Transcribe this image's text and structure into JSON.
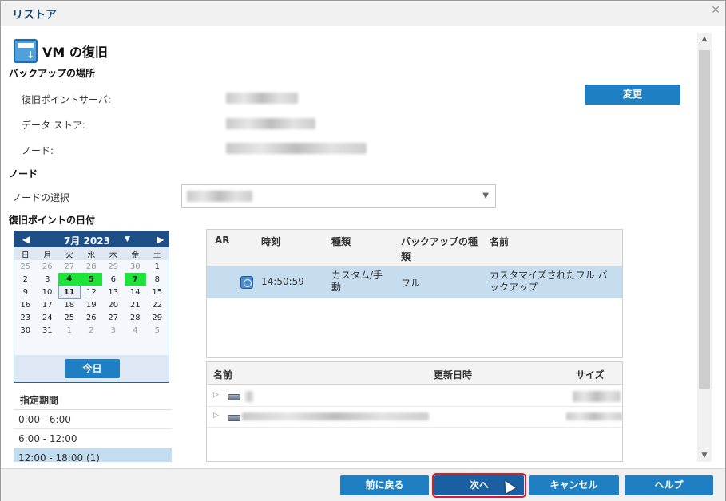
{
  "window": {
    "title": "リストア"
  },
  "header": {
    "title": "VM の復旧"
  },
  "backup_location": {
    "heading": "バックアップの場所",
    "fields": [
      {
        "label": "復旧ポイントサーバ:"
      },
      {
        "label": "データ ストア:"
      },
      {
        "label": "ノード:"
      }
    ],
    "change_button": "変更"
  },
  "node": {
    "heading": "ノード",
    "select_label": "ノードの選択"
  },
  "recovery_date": {
    "heading": "復旧ポイントの日付"
  },
  "calendar": {
    "month_label": "7月 2023",
    "weekdays": [
      "日",
      "月",
      "火",
      "水",
      "木",
      "金",
      "土"
    ],
    "weeks": [
      [
        "25",
        "26",
        "27",
        "28",
        "29",
        "30",
        "1"
      ],
      [
        "2",
        "3",
        "4",
        "5",
        "6",
        "7",
        "8"
      ],
      [
        "9",
        "10",
        "11",
        "12",
        "13",
        "14",
        "15"
      ],
      [
        "16",
        "17",
        "18",
        "19",
        "20",
        "21",
        "22"
      ],
      [
        "23",
        "24",
        "25",
        "26",
        "27",
        "28",
        "29"
      ],
      [
        "30",
        "31",
        "1",
        "2",
        "3",
        "4",
        "5"
      ]
    ],
    "today_button": "今日"
  },
  "period": {
    "heading": "指定期間",
    "items": [
      "0:00 - 6:00",
      "6:00 - 12:00",
      "12:00 - 18:00   (1)"
    ]
  },
  "recovery_table": {
    "headers": {
      "ar": "AR",
      "time": "時刻",
      "type": "種類",
      "backup_type": "バックアップの種類",
      "name": "名前"
    },
    "rows": [
      {
        "time": "14:50:59",
        "type": "カスタム/手動",
        "backup_type": "フル",
        "name": "カスタマイズされたフル バックアップ"
      }
    ]
  },
  "file_table": {
    "headers": {
      "name": "名前",
      "modified": "更新日時",
      "size": "サイズ"
    }
  },
  "footer": {
    "back": "前に戻る",
    "next": "次へ",
    "cancel": "キャンセル",
    "help": "ヘルプ"
  },
  "colors": {
    "accent": "#1f7fc3",
    "highlight_day": "#1fe23b",
    "selected_row": "#c6ddef",
    "focus_outline": "#e0182a"
  }
}
